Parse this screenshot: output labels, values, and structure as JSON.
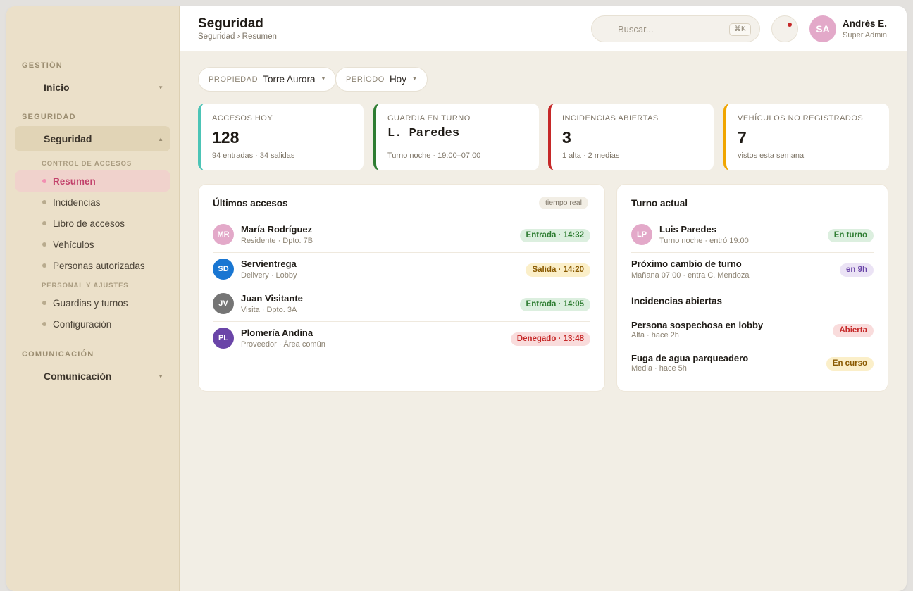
{
  "sidebar": {
    "sections": {
      "gestion": "GESTIÓN",
      "seguridad": "SEGURIDAD",
      "comunicacion": "COMUNICACIÓN"
    },
    "inicio": "Inicio",
    "seguridad": "Seguridad",
    "comunicacion": "Comunicación",
    "sub_control": "CONTROL DE ACCESOS",
    "sub_personal": "PERSONAL Y AJUSTES",
    "items": [
      {
        "label": "Resumen"
      },
      {
        "label": "Incidencias"
      },
      {
        "label": "Libro de accesos"
      },
      {
        "label": "Vehículos"
      },
      {
        "label": "Personas autorizadas"
      },
      {
        "label": "Guardias y turnos"
      },
      {
        "label": "Configuración"
      }
    ]
  },
  "header": {
    "title": "Seguridad",
    "breadcrumb": "Seguridad › Resumen",
    "search_placeholder": "Buscar...",
    "search_shortcut": "⌘K",
    "user_initials": "SA",
    "user_name": "Andrés E.",
    "user_role": "Super Admin"
  },
  "filters": {
    "propiedad_label": "PROPIEDAD",
    "propiedad_value": "Torre Aurora",
    "periodo_label": "PERÍODO",
    "periodo_value": "Hoy"
  },
  "kpis": [
    {
      "label": "ACCESOS HOY",
      "value": "128",
      "sub": "94 entradas · 34 salidas",
      "color": "#4cc4b6"
    },
    {
      "label": "GUARDIA EN TURNO",
      "value": "L. Paredes",
      "sub": "Turno noche · 19:00–07:00",
      "color": "#2e7d32"
    },
    {
      "label": "INCIDENCIAS ABIERTAS",
      "value": "3",
      "sub": "1 alta · 2 medias",
      "color": "#c62828"
    },
    {
      "label": "VEHÍCULOS NO REGISTRADOS",
      "value": "7",
      "sub": "vistos esta semana",
      "color": "#f0a500"
    }
  ],
  "accesses": {
    "title": "Últimos accesos",
    "badge": "tiempo real",
    "rows": [
      {
        "initials": "MR",
        "name": "María Rodríguez",
        "meta": "Residente · Dpto. 7B",
        "status": "Entrada · 14:32",
        "avatar_color": "#e3a9c9"
      },
      {
        "initials": "SD",
        "name": "Servientrega",
        "meta": "Delivery · Lobby",
        "status": "Salida · 14:20",
        "avatar_color": "#1976d2"
      },
      {
        "initials": "JV",
        "name": "Juan Visitante",
        "meta": "Visita · Dpto. 3A",
        "status": "Entrada · 14:05",
        "avatar_color": "#757575"
      },
      {
        "initials": "PL",
        "name": "Plomería Andina",
        "meta": "Proveedor · Área común",
        "status": "Denegado · 13:48",
        "avatar_color": "#6a45a8"
      }
    ]
  },
  "shift": {
    "title": "Turno actual",
    "guard_initials": "LP",
    "guard_name": "Luis Paredes",
    "guard_meta": "Turno noche · entró 19:00",
    "guard_status": "En turno",
    "next_title": "Próximo cambio de turno",
    "next_meta": "Mañana 07:00 · entra C. Mendoza",
    "next_badge": "en 9h",
    "incidents_title": "Incidencias abiertas",
    "incidents": [
      {
        "title": "Persona sospechosa en lobby",
        "meta": "Alta · hace 2h",
        "status": "Abierta"
      },
      {
        "title": "Fuga de agua parqueadero",
        "meta": "Media · hace 5h",
        "status": "En curso"
      }
    ]
  }
}
